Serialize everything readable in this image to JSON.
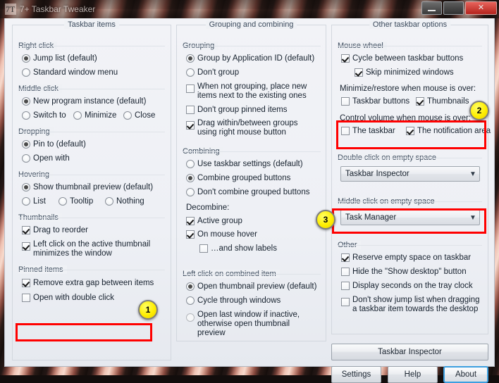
{
  "window": {
    "title": "7+ Taskbar Tweaker",
    "icon": "app-icon",
    "minimize_label": "–",
    "maximize_label": "",
    "close_label": "✕"
  },
  "taskbar_items": {
    "caption": "Taskbar items",
    "right_click": {
      "caption": "Right click",
      "options": [
        {
          "label": "Jump list (default)",
          "selected": true
        },
        {
          "label": "Standard window menu",
          "selected": false
        }
      ]
    },
    "middle_click": {
      "caption": "Middle click",
      "options": [
        {
          "label": "New program instance (default)",
          "selected": true
        },
        {
          "label": "Switch to",
          "selected": false
        },
        {
          "label": "Minimize",
          "selected": false
        },
        {
          "label": "Close",
          "selected": false
        }
      ]
    },
    "dropping": {
      "caption": "Dropping",
      "options": [
        {
          "label": "Pin to (default)",
          "selected": true
        },
        {
          "label": "Open with",
          "selected": false
        }
      ]
    },
    "hovering": {
      "caption": "Hovering",
      "options": [
        {
          "label": "Show thumbnail preview (default)",
          "selected": true
        },
        {
          "label": "List",
          "selected": false
        },
        {
          "label": "Tooltip",
          "selected": false
        },
        {
          "label": "Nothing",
          "selected": false
        }
      ]
    },
    "thumbnails": {
      "caption": "Thumbnails",
      "options": [
        {
          "label": "Drag to reorder",
          "checked": true
        },
        {
          "label": "Left click on the active thumbnail minimizes the window",
          "checked": true
        }
      ]
    },
    "pinned_items": {
      "caption": "Pinned items",
      "options": [
        {
          "label": "Remove extra gap between items",
          "checked": true,
          "highlighted": true
        },
        {
          "label": "Open with double click",
          "checked": false,
          "highlighted": false
        }
      ]
    }
  },
  "grouping_combining": {
    "caption": "Grouping and combining",
    "grouping": {
      "caption": "Grouping",
      "radios": [
        {
          "label": "Group by Application ID (default)",
          "selected": true
        },
        {
          "label": "Don't group",
          "selected": false
        }
      ],
      "checks": [
        {
          "label": "When not grouping, place new items next to the existing ones",
          "checked": false
        },
        {
          "label": "Don't group pinned items",
          "checked": false
        },
        {
          "label": "Drag within/between groups using right mouse button",
          "checked": true
        }
      ]
    },
    "combining": {
      "caption": "Combining",
      "radios": [
        {
          "label": "Use taskbar settings (default)",
          "selected": false
        },
        {
          "label": "Combine grouped buttons",
          "selected": true
        },
        {
          "label": "Don't combine grouped buttons",
          "selected": false
        }
      ],
      "decombine_label": "Decombine:",
      "checks": [
        {
          "label": "Active group",
          "checked": true,
          "indent": false
        },
        {
          "label": "On mouse hover",
          "checked": true,
          "indent": false
        },
        {
          "label": "…and show labels",
          "checked": false,
          "indent": true
        }
      ]
    },
    "left_click": {
      "caption": "Left click on combined item",
      "options": [
        {
          "label": "Open thumbnail preview (default)",
          "selected": true
        },
        {
          "label": "Cycle through windows",
          "selected": false
        },
        {
          "label": "Open last window if inactive, otherwise open thumbnail preview",
          "selected": false
        }
      ]
    }
  },
  "other_taskbar_options": {
    "caption": "Other taskbar options",
    "mouse_wheel": {
      "caption": "Mouse wheel",
      "checks": [
        {
          "label": "Cycle between taskbar buttons",
          "checked": true
        },
        {
          "label": "Skip minimized windows",
          "checked": true
        }
      ],
      "minimize_restore_label": "Minimize/restore when mouse is over:",
      "minimize_restore_checks": [
        {
          "label": "Taskbar buttons",
          "checked": false
        },
        {
          "label": "Thumbnails",
          "checked": true
        }
      ],
      "control_volume_label": "Control volume when mouse is over:",
      "control_volume_checks": [
        {
          "label": "The taskbar",
          "checked": false
        },
        {
          "label": "The notification area",
          "checked": true
        }
      ]
    },
    "double_click": {
      "caption": "Double click on empty space",
      "value": "Taskbar Inspector"
    },
    "middle_click": {
      "caption": "Middle click on empty space",
      "value": "Task Manager"
    },
    "other": {
      "caption": "Other",
      "checks": [
        {
          "label": "Reserve empty space on taskbar",
          "checked": true
        },
        {
          "label": "Hide the \"Show desktop\" button",
          "checked": false
        },
        {
          "label": "Display seconds on the tray clock",
          "checked": false
        },
        {
          "label": "Don't show jump list when dragging a taskbar item towards the desktop",
          "checked": false
        }
      ]
    },
    "buttons": {
      "inspector": "Taskbar Inspector",
      "settings": "Settings",
      "help": "Help",
      "about": "About"
    }
  },
  "annotations": {
    "badges": [
      {
        "number": "1"
      },
      {
        "number": "2"
      },
      {
        "number": "3"
      }
    ],
    "highlight_color": "#ff0000",
    "badge_color": "#ffee00"
  }
}
